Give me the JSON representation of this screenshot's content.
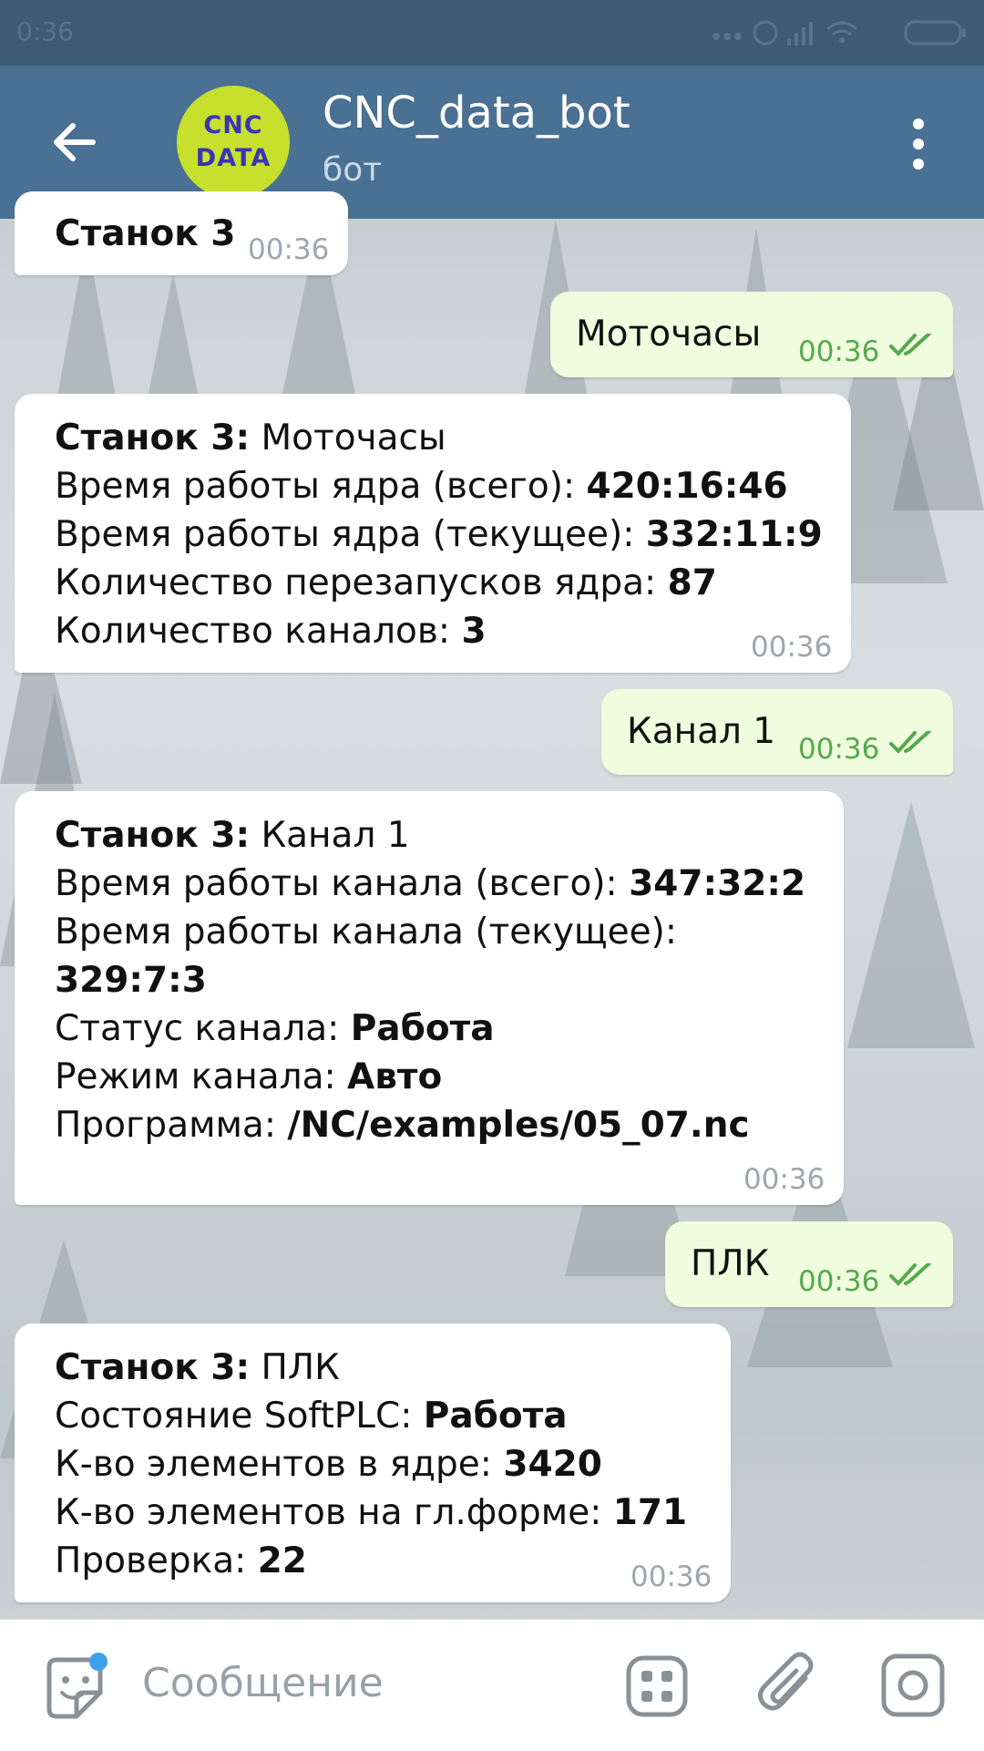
{
  "status_bar": {
    "time": "0:36"
  },
  "header": {
    "title": "CNC_data_bot",
    "subtitle": "бот",
    "avatar_line1": "CNC",
    "avatar_line2": "DATA"
  },
  "messages": [
    {
      "dir": "in",
      "lines": [
        {
          "bold": "Станок 3",
          "rest": ""
        }
      ],
      "time": "00:36"
    },
    {
      "dir": "out",
      "lines": [
        {
          "bold": "",
          "rest": "Моточасы"
        }
      ],
      "time": "00:36"
    },
    {
      "dir": "in",
      "lines": [
        {
          "bold": "Станок 3:",
          "rest": " Моточасы"
        },
        {
          "rest": "Время работы ядра (всего): ",
          "bold_after": "420:16:46"
        },
        {
          "rest": "Время работы ядра (текущее): ",
          "bold_after": "332:11:9"
        },
        {
          "rest": "Количество перезапусков ядра: ",
          "bold_after": "87"
        },
        {
          "rest": "Количество каналов: ",
          "bold_after": "3"
        }
      ],
      "time": "00:36"
    },
    {
      "dir": "out",
      "lines": [
        {
          "rest": "Канал 1"
        }
      ],
      "time": "00:36"
    },
    {
      "dir": "in",
      "lines": [
        {
          "bold": "Станок 3:",
          "rest": " Канал 1"
        },
        {
          "rest": "Время работы канала (всего): ",
          "bold_after": "347:32:2"
        },
        {
          "rest": "Время работы канала (текущее):"
        },
        {
          "bold": "329:7:3"
        },
        {
          "rest": "Статус канала: ",
          "bold_after": "Работа"
        },
        {
          "rest": "Режим канала: ",
          "bold_after": "Авто"
        },
        {
          "rest": "Программа: ",
          "bold_after": "/NC/examples/05_07.nc"
        }
      ],
      "time": "00:36"
    },
    {
      "dir": "out",
      "lines": [
        {
          "rest": "ПЛК"
        }
      ],
      "time": "00:36"
    },
    {
      "dir": "in",
      "lines": [
        {
          "bold": "Станок 3:",
          "rest": " ПЛК"
        },
        {
          "rest": "Состояние SoftPLC: ",
          "bold_after": "Работа"
        },
        {
          "rest": "К-во элементов в ядре: ",
          "bold_after": "3420"
        },
        {
          "rest": "К-во элементов на гл.форме: ",
          "bold_after": "171"
        },
        {
          "rest": "Проверка: ",
          "bold_after": "22"
        }
      ],
      "time": "00:36"
    }
  ],
  "composer": {
    "placeholder": "Сообщение"
  },
  "icons": {
    "back": "arrow-left-icon",
    "menu": "more-vertical-icon",
    "sticker": "sticker-icon",
    "bot_commands": "bot-commands-icon",
    "attach": "paperclip-icon",
    "camera": "camera-icon",
    "read": "double-check-icon"
  },
  "colors": {
    "header": "#4a7093",
    "statusbar": "#3d5b74",
    "outgoing": "#effdde",
    "read_green": "#57a84d",
    "badge": "#3fa0ea"
  }
}
